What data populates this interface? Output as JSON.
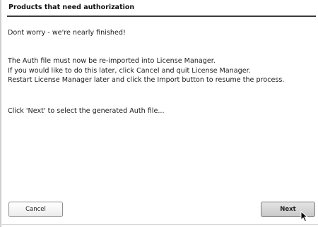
{
  "header": {
    "title": "Products that need authorization"
  },
  "content": {
    "intro": "Dont worry - we're nearly finished!",
    "paragraph": [
      "The Auth file must now be re-imported into License Manager.",
      "If you would like to do this later, click Cancel and quit License Manager.",
      "Restart License Manager later and click the Import button to resume the process."
    ],
    "next_instruction": "Click 'Next' to select the generated Auth file..."
  },
  "buttons": {
    "cancel_label": "Cancel",
    "next_label": "Next"
  },
  "icons": {
    "cursor": "mouse-pointer-icon"
  }
}
